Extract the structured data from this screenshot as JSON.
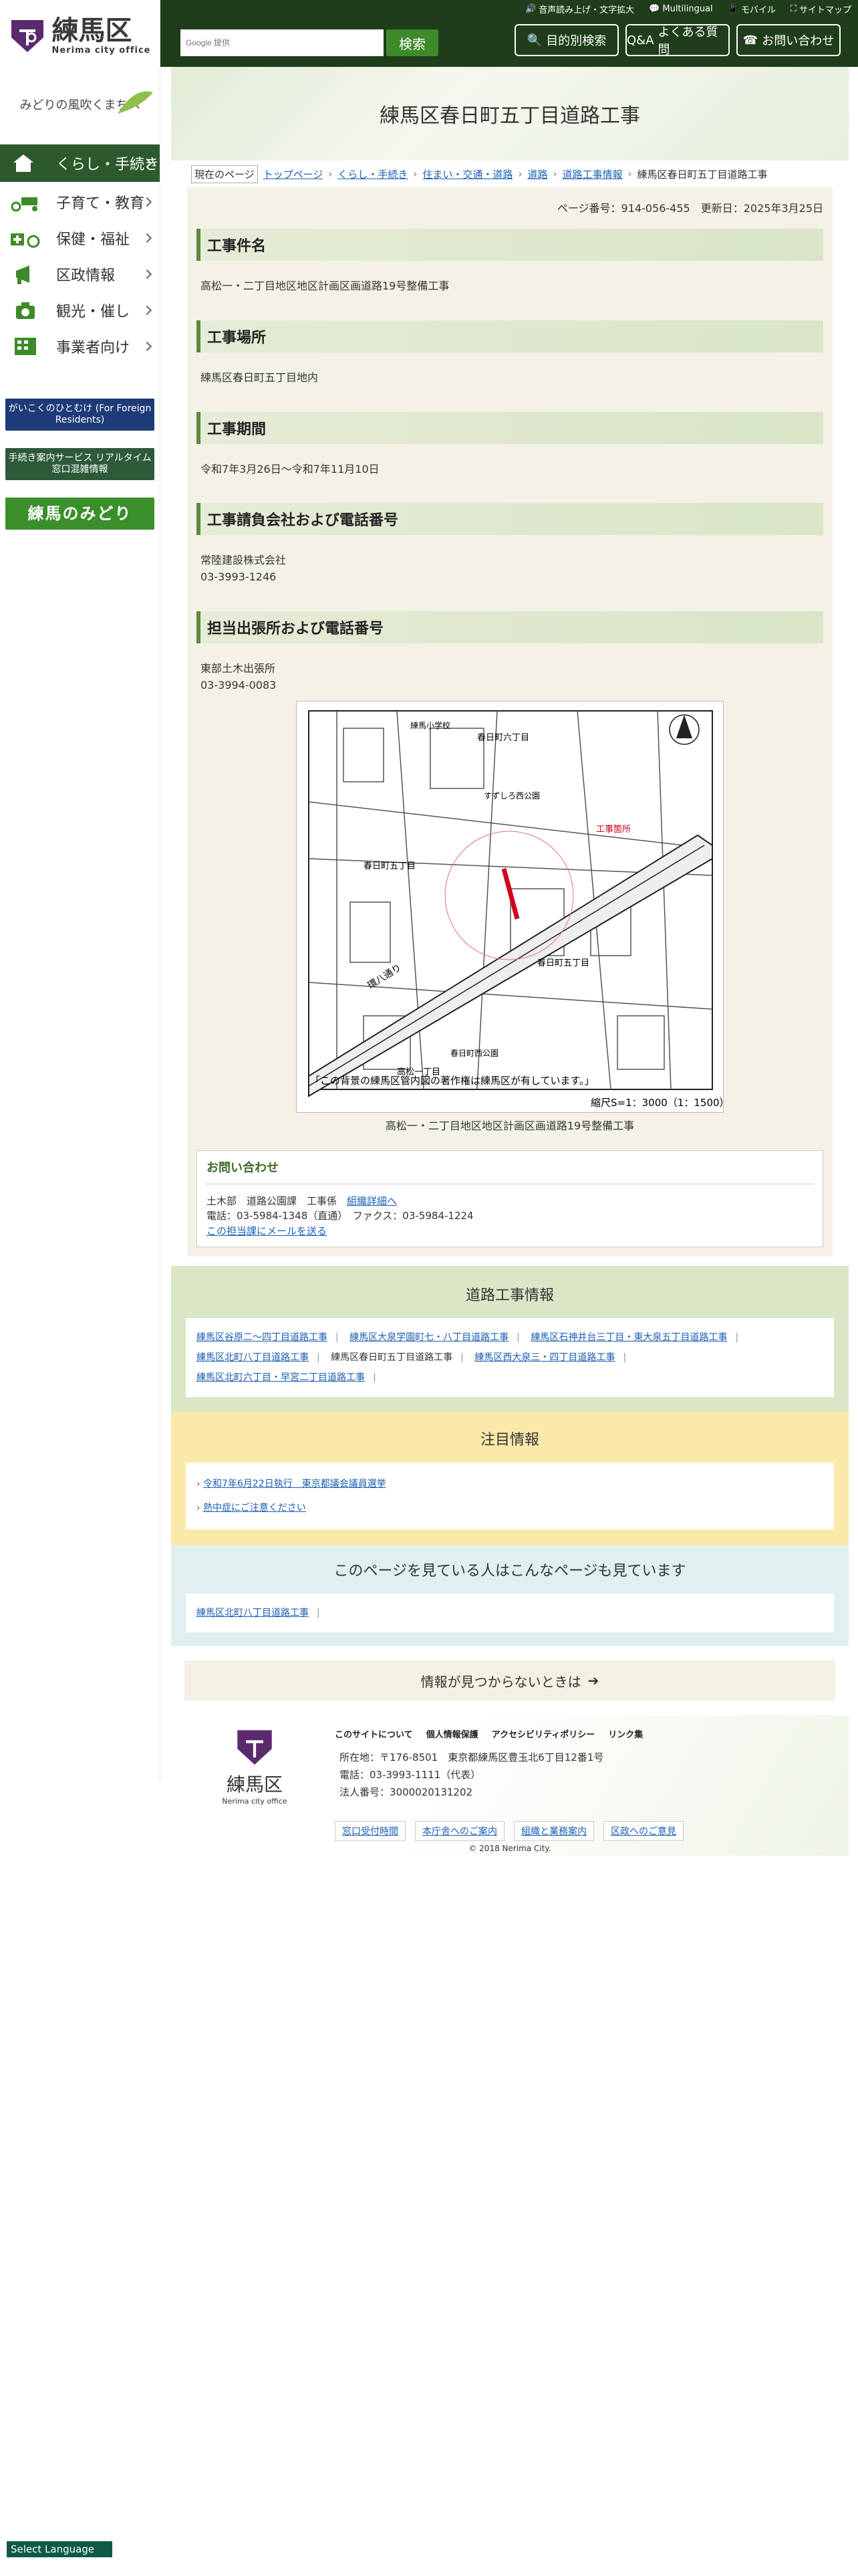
{
  "header": {
    "util_links": [
      "音声読み上げ・文字拡大",
      "Multilingual",
      "モバイル",
      "サイトマップ"
    ],
    "search_placeholder": "Google 提供",
    "search_button": "検索",
    "buttons": [
      "目的別検索",
      "よくある質問",
      "お問い合わせ"
    ],
    "qa_prefix": "Q&A"
  },
  "logo": {
    "ja": "練馬区",
    "en": "Nerima city office"
  },
  "catch": "みどりの風吹くまちへ",
  "sidebar": {
    "items": [
      "くらし・手続き",
      "子育て・教育",
      "保健・福祉",
      "区政情報",
      "観光・催し",
      "事業者向け"
    ],
    "banners": [
      "がいこくのひとむけ (For Foreign Residents)",
      "手続き案内サービス リアルタイム窓口混雑情報",
      "練馬のみどり"
    ]
  },
  "page": {
    "title": "練馬区春日町五丁目道路工事",
    "breadcrumb_label": "現在のページ",
    "breadcrumbs": [
      "トップページ",
      "くらし・手続き",
      "住まい・交通・道路",
      "道路",
      "道路工事情報",
      "練馬区春日町五丁目道路工事"
    ],
    "page_id": "ページ番号：914-056-455",
    "updated": "更新日：2025年3月25日",
    "sections": [
      {
        "heading": "工事件名",
        "body": "高松一・二丁目地区地区計画区画道路19号整備工事"
      },
      {
        "heading": "工事場所",
        "body": "練馬区春日町五丁目地内"
      },
      {
        "heading": "工事期間",
        "body": "令和7年3月26日～令和7年11月10日"
      },
      {
        "heading": "工事請負会社および電話番号",
        "body": "常陸建設株式会社",
        "body2": "03-3993-1246"
      },
      {
        "heading": "担当出張所および電話番号",
        "body": "東部土木出張所",
        "body2": "03-3994-0083"
      }
    ],
    "map": {
      "labels": [
        "練馬小学校",
        "春日町六丁目",
        "すずしろ西公園",
        "工事箇所",
        "春日町五丁目",
        "春日町五丁目",
        "環八通り",
        "高松一丁目",
        "春日町西公園"
      ],
      "copyright_note": "「この背景の練馬区管内図の著作権は練馬区が有しています。」",
      "scale": "縮尺S=1：3000（1：1500）"
    },
    "caption": "高松一・二丁目地区地区計画区画道路19号整備工事",
    "contact": {
      "heading": "お問い合わせ",
      "dept": "土木部　道路公園課　工事係",
      "detail_link": "組織詳細へ",
      "phone": "電話：03-5984-1348（直通）　ファクス：03-5984-1224",
      "mail_link": "この担当課にメールを送る"
    }
  },
  "road_info": {
    "title": "道路工事情報",
    "links": [
      "練馬区谷原二～四丁目道路工事",
      "練馬区大泉学園町七・八丁目道路工事",
      "練馬区石神井台三丁目・東大泉五丁目道路工事",
      "練馬区北町八丁目道路工事",
      "練馬区春日町五丁目道路工事",
      "練馬区西大泉三・四丁目道路工事",
      "練馬区北町六丁目・早宮二丁目道路工事"
    ]
  },
  "notice": {
    "title": "注目情報",
    "links": [
      "令和7年6月22日執行　東京都議会議員選挙",
      "熱中症にご注意ください"
    ]
  },
  "related": {
    "title": "このページを見ている人はこんなページも見ています",
    "links": [
      "練馬区北町八丁目道路工事"
    ]
  },
  "notfound": "情報が見つからないときは",
  "footer": {
    "links": [
      "このサイトについて",
      "個人情報保護",
      "アクセシビリティポリシー",
      "リンク集"
    ],
    "address": "所在地：〒176-8501　東京都練馬区豊玉北6丁目12番1号",
    "phone": "電話：03-3993-1111（代表）",
    "corp": "法人番号：3000020131202",
    "buttons": [
      "窓口受付時間",
      "本庁舎へのご案内",
      "組織と業務案内",
      "区政へのご意見"
    ],
    "copyright": "© 2018 Nerima City."
  },
  "lang": "Select Language",
  "colors": {
    "header": "#1f3d1a",
    "accent": "#5a8a3a",
    "road": "#d0021b"
  }
}
